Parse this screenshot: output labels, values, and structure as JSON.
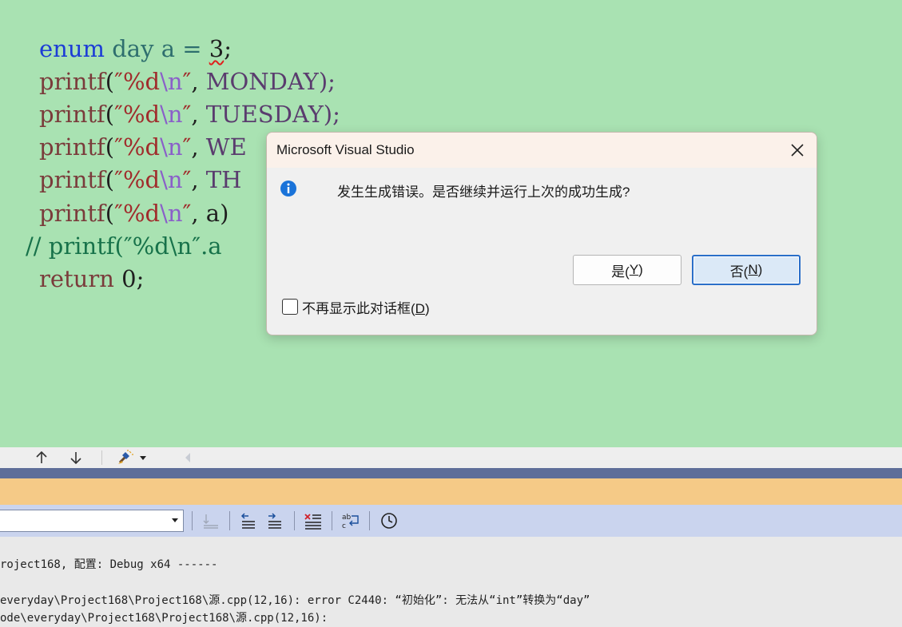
{
  "editor": {
    "line1": {
      "kw": "enum",
      "type": "day",
      "rest_a": " a = ",
      "num": "3",
      "end": ";"
    },
    "printf_fn": "printf",
    "paren_open": "(",
    "quote_open": "″",
    "fmt": "%d",
    "esc": "\\n",
    "quote_close": "″",
    "comma": ",",
    "line2_arg": " MONDAY);",
    "line3_arg": " TUESDAY);",
    "line4_arg": " WE",
    "line5_arg": " TH",
    "line6_arg": " a)",
    "comment": "// printf(″%d\\n″.a",
    "return_kw": "return",
    "return_rest": " 0;"
  },
  "output_lines": [
    "roject168, 配置: Debug x64 ------",
    "everyday\\Project168\\Project168\\源.cpp(12,16): error C2440: “初始化”: 无法从“int”转换为“day”",
    "ode\\everyday\\Project168\\Project168\\源.cpp(12,16):"
  ],
  "dialog": {
    "title": "Microsoft Visual Studio",
    "message": "发生生成错误。是否继续并运行上次的成功生成?",
    "yes_label": "是(",
    "yes_mnemonic": "Y",
    "yes_close": ")",
    "no_label": "否(",
    "no_mnemonic": "N",
    "no_close": ")",
    "checkbox_label": "不再显示此对话框(",
    "checkbox_mnemonic": "D",
    "checkbox_close": ")",
    "checkbox_checked": false
  },
  "icons": {
    "nav_up": "arrow-up-icon",
    "nav_down": "arrow-down-icon",
    "nav_brush": "brush-icon",
    "nav_left": "chevron-left-icon",
    "close": "close-icon",
    "info": "info-icon"
  },
  "colors": {
    "editor_bg": "#a9e2b2",
    "accent_blue": "#2a6fc9",
    "info_blue": "#1a73d9",
    "error_squiggle": "#e0201e"
  }
}
